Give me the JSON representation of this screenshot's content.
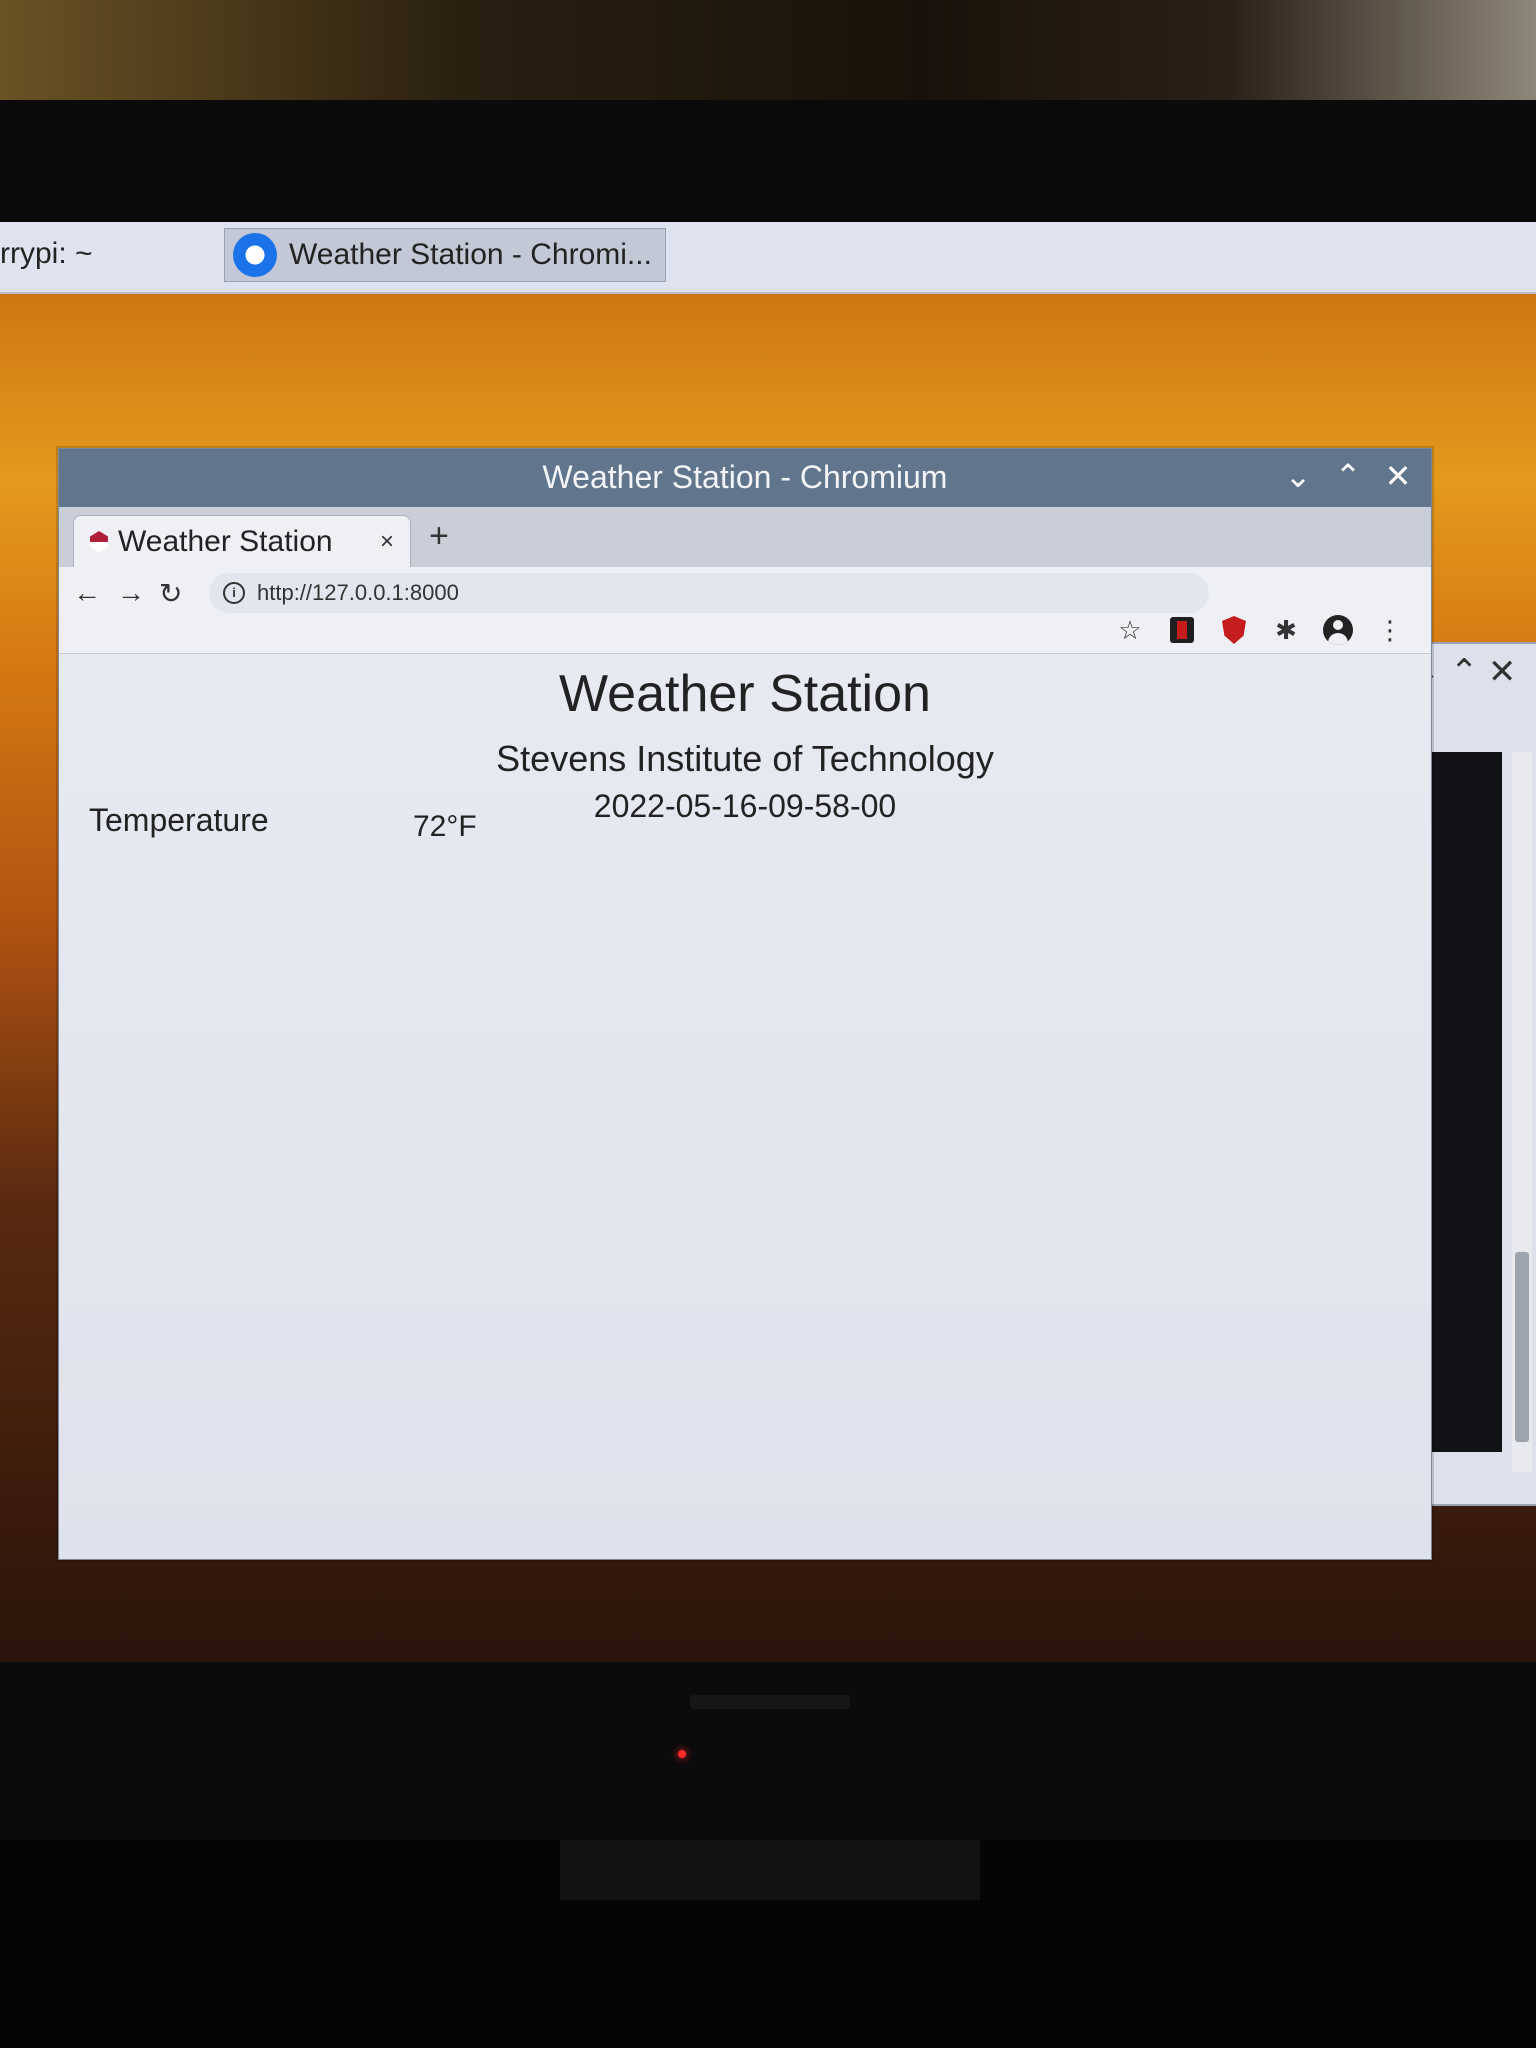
{
  "taskbar": {
    "left_item_label": "rrypi: ~",
    "active_item_label": "Weather Station - Chromi..."
  },
  "window": {
    "title": "Weather Station - Chromium",
    "controls": {
      "minimize": "⌄",
      "maximize": "⌃",
      "close": "✕"
    }
  },
  "tabs": [
    {
      "title": "Weather Station",
      "close": "×"
    }
  ],
  "toolbar": {
    "back": "←",
    "forward": "→",
    "reload": "↻",
    "url": "http://127.0.0.1:8000",
    "new_tab": "+",
    "bookmark": "☆",
    "menu": "⋮"
  },
  "page": {
    "title": "Weather Station",
    "subtitle": "Stevens Institute of Technology",
    "timestamp": "2022-05-16-09-58-00",
    "readings": [
      {
        "label": "Temperature",
        "value": "72°F"
      }
    ]
  },
  "bg_window": {
    "controls": "⌄ ⌃ ✕"
  },
  "colors": {
    "titlebar": "#61758c",
    "page_bg": "#e8eaf2",
    "power_led": "#ff2a2a"
  }
}
